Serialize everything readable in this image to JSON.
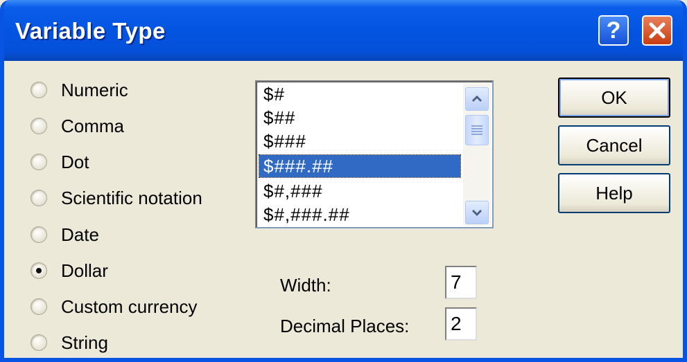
{
  "window": {
    "title": "Variable Type"
  },
  "titlebar": {
    "help_label": "?"
  },
  "radios": [
    {
      "label": "Numeric",
      "checked": false
    },
    {
      "label": "Comma",
      "checked": false
    },
    {
      "label": "Dot",
      "checked": false
    },
    {
      "label": "Scientific notation",
      "checked": false
    },
    {
      "label": "Date",
      "checked": false
    },
    {
      "label": "Dollar",
      "checked": true
    },
    {
      "label": "Custom currency",
      "checked": false
    },
    {
      "label": "String",
      "checked": false
    }
  ],
  "format_list": {
    "items": [
      "$#",
      "$##",
      "$###",
      "$###.##",
      "$#,###",
      "$#,###.##"
    ],
    "selected": "$###.##"
  },
  "buttons": {
    "ok": "OK",
    "cancel": "Cancel",
    "help": "Help"
  },
  "fields": {
    "width_label": "Width:",
    "width_value": "7",
    "decimal_label": "Decimal Places:",
    "decimal_value": "2"
  }
}
